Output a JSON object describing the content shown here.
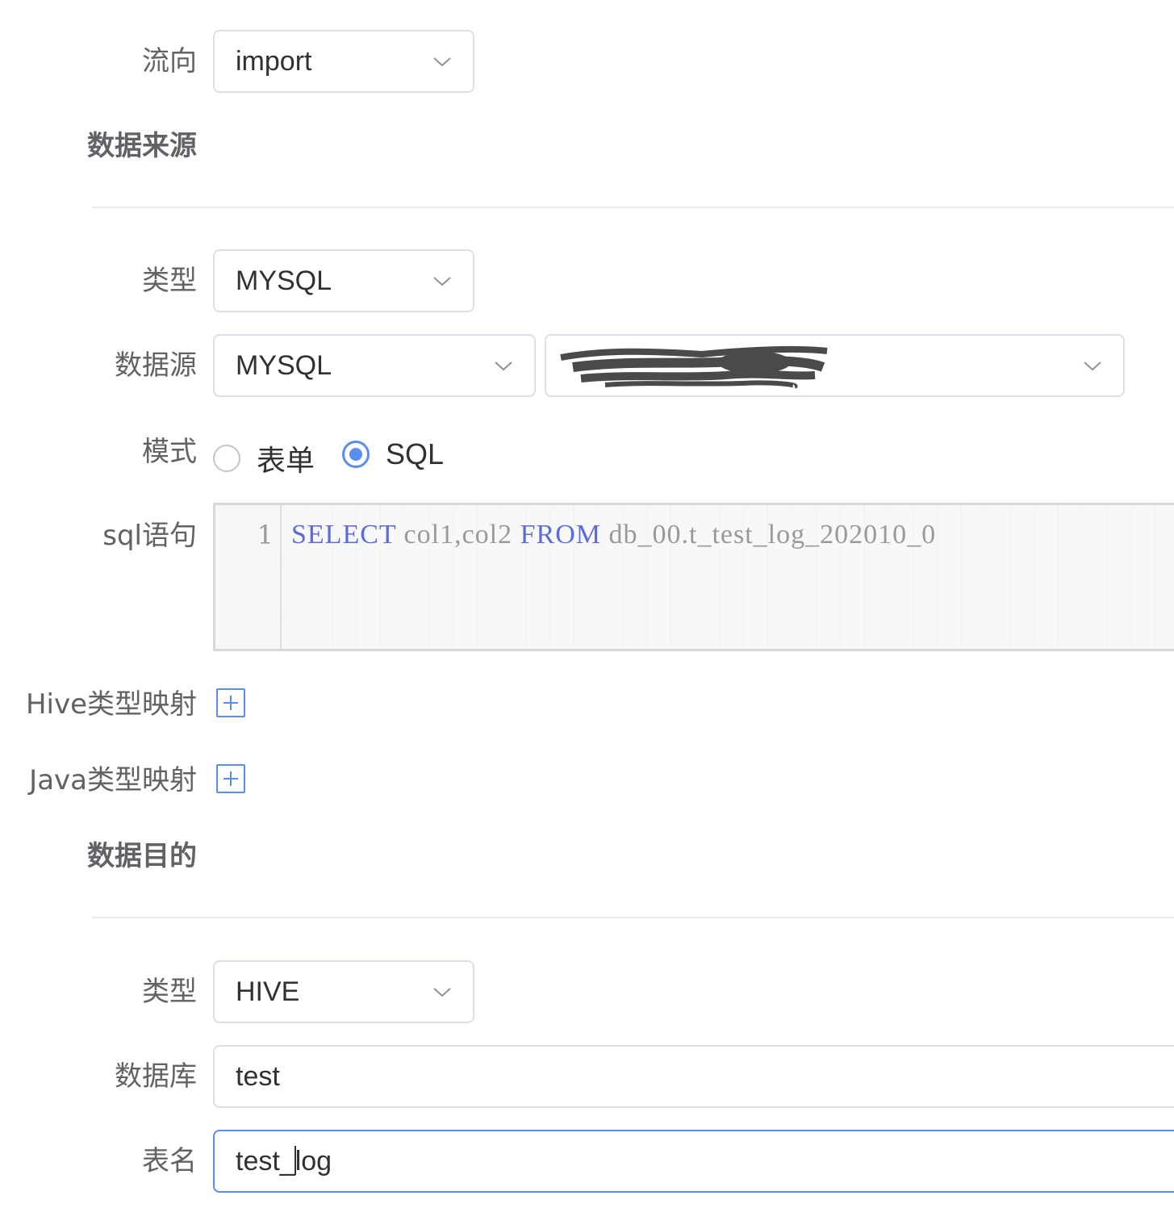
{
  "flow": {
    "label": "流向",
    "value": "import"
  },
  "source": {
    "title": "数据来源",
    "type": {
      "label": "类型",
      "value": "MYSQL"
    },
    "datasource": {
      "label": "数据源",
      "value": "MYSQL",
      "instance_value": ""
    },
    "mode": {
      "label": "模式",
      "options": [
        "表单",
        "SQL"
      ],
      "selected": "SQL"
    },
    "sql": {
      "label": "sql语句",
      "line_number": "1",
      "kw_select": "SELECT",
      "cols": " col1,col2 ",
      "kw_from": "FROM",
      "table": " db_00.t_test_log_202010_0"
    },
    "hive_mapping": {
      "label": "Hive类型映射"
    },
    "java_mapping": {
      "label": "Java类型映射"
    }
  },
  "target": {
    "title": "数据目的",
    "type": {
      "label": "类型",
      "value": "HIVE"
    },
    "database": {
      "label": "数据库",
      "value": "test"
    },
    "table": {
      "label": "表名",
      "value_before_cursor": "test_",
      "value_after_cursor": "log"
    }
  },
  "colors": {
    "accent": "#5b8def",
    "border": "#dcdfe6",
    "label": "#606266",
    "keyword": "#5b6bd9"
  },
  "icons": [
    "chevron-down-icon",
    "plus-square-icon"
  ]
}
